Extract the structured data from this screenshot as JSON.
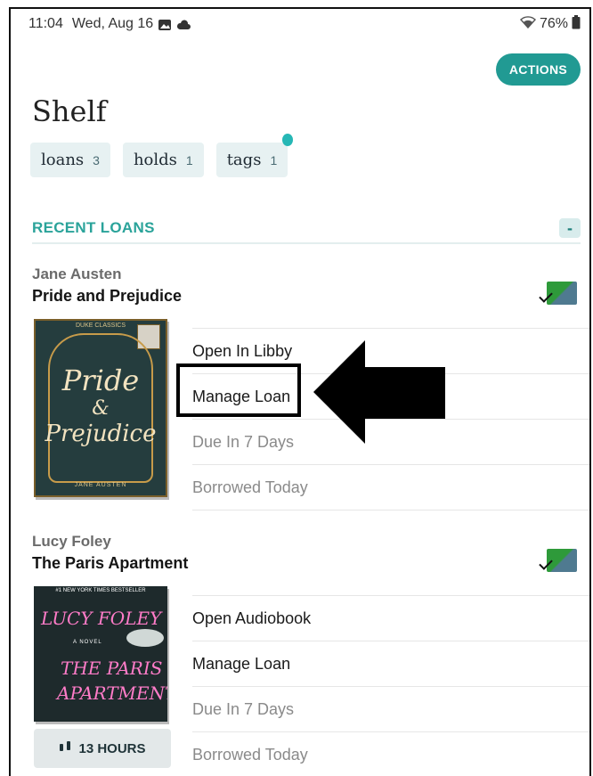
{
  "status_bar": {
    "time": "11:04",
    "date": "Wed, Aug 16",
    "battery": "76%",
    "icons": [
      "image-icon",
      "cloud-icon",
      "wifi-icon",
      "battery-icon"
    ]
  },
  "header": {
    "actions_label": "ACTIONS",
    "title": "Shelf"
  },
  "chips": [
    {
      "label": "loans",
      "count": "3"
    },
    {
      "label": "holds",
      "count": "1"
    },
    {
      "label": "tags",
      "count": "1"
    }
  ],
  "section": {
    "label": "RECENT LOANS",
    "collapse": "-"
  },
  "books": [
    {
      "author": "Jane Austen",
      "title": "Pride and Prejudice",
      "cover": {
        "top": "DUKE CLASSICS",
        "line1": "Pride",
        "line2": "&",
        "line3": "Prejudice",
        "bottom": "JANE AUSTEN"
      },
      "actions": [
        "Open In Libby",
        "Manage Loan",
        "Due In 7 Days",
        "Borrowed Today"
      ]
    },
    {
      "author": "Lucy Foley",
      "title": "The Paris Apartment",
      "cover": {
        "top": "#1 NEW YORK TIMES BESTSELLER",
        "line1": "LUCY FOLEY",
        "novel": "A NOVEL",
        "line2": "THE PARIS",
        "line3": "APARTMENT"
      },
      "hours_label": "13 HOURS",
      "actions": [
        "Open Audiobook",
        "Manage Loan",
        "Due In 7 Days",
        "Borrowed Today"
      ]
    }
  ],
  "colors": {
    "accent": "#219a93",
    "section_label": "#2aa39a",
    "chip_bg": "#e7f1f2",
    "muted_text": "#8a8a8a"
  }
}
